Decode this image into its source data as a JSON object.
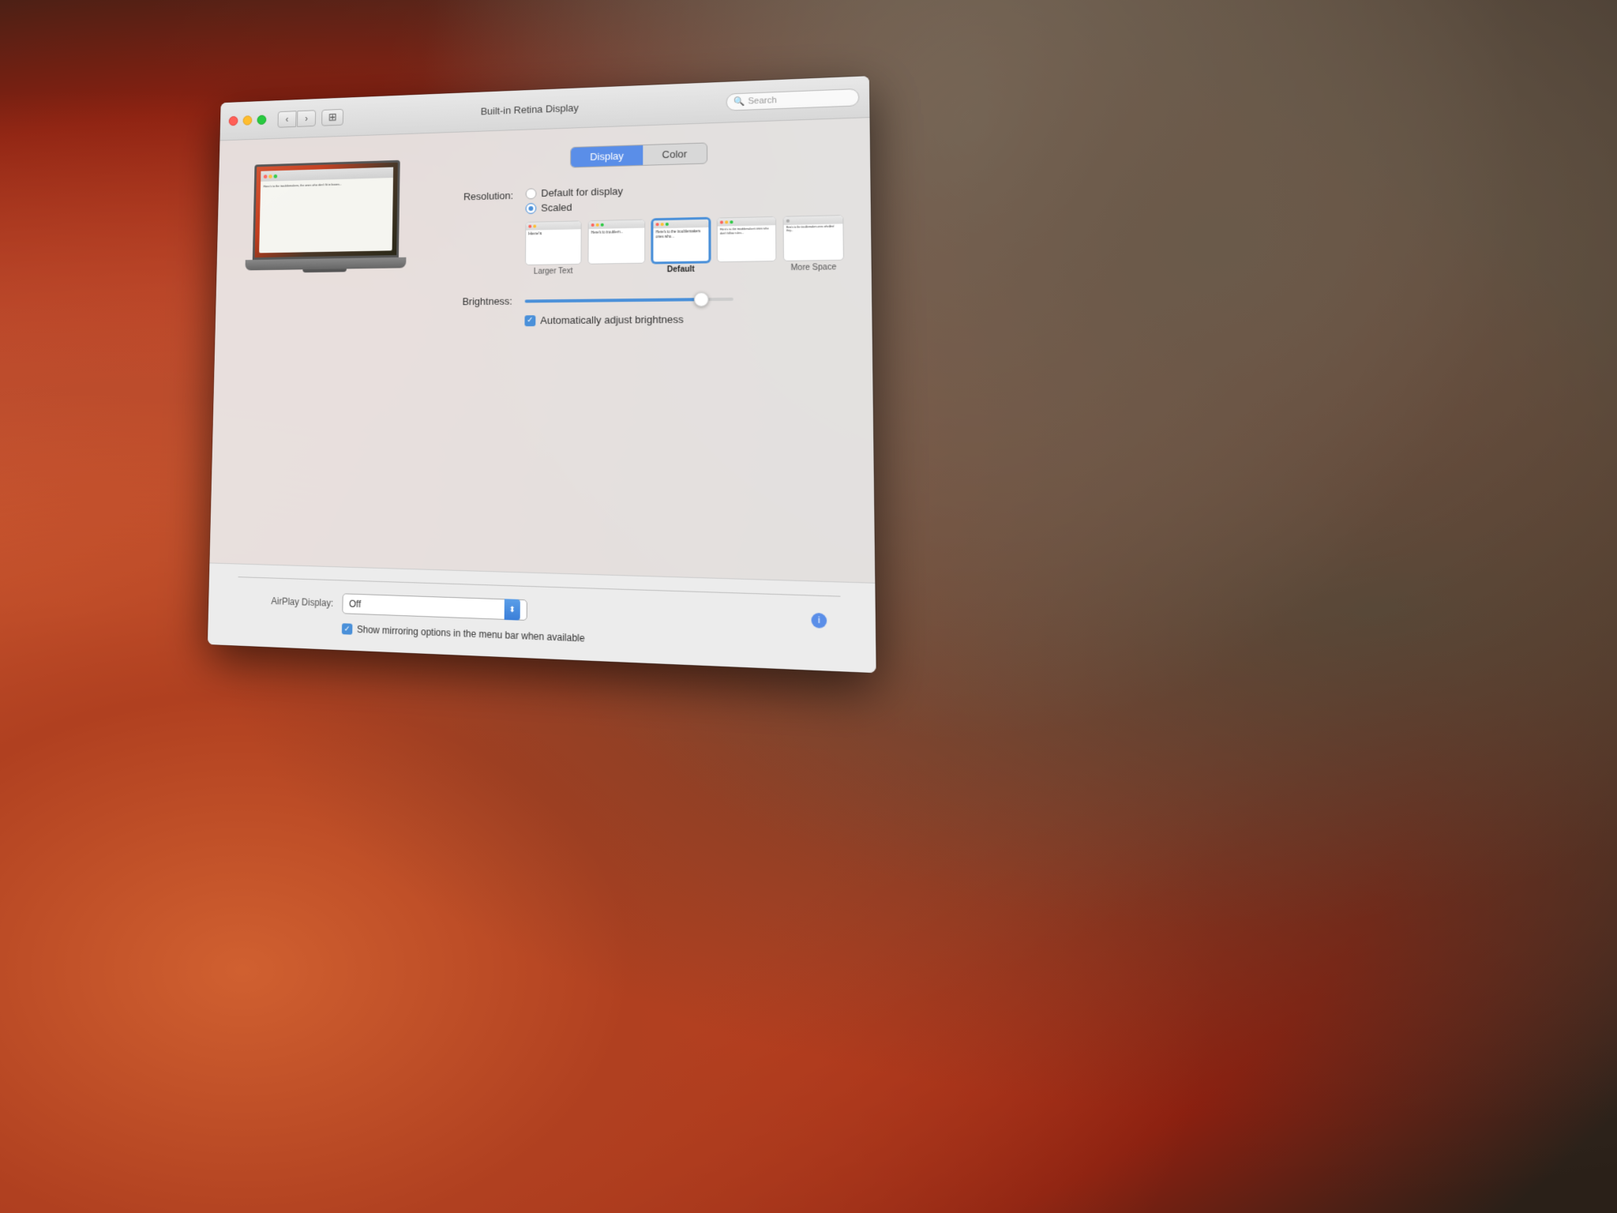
{
  "background": {
    "description": "macOS Yosemite wallpaper with El Capitan rock formation"
  },
  "window": {
    "title": "Built-in Retina Display",
    "traffic_lights": {
      "close": "close",
      "minimize": "minimize",
      "maximize": "maximize"
    },
    "nav": {
      "back": "‹",
      "forward": "›",
      "grid": "⊞"
    },
    "search": {
      "placeholder": "Search"
    }
  },
  "tabs": {
    "display": "Display",
    "color": "Color",
    "active": "display"
  },
  "resolution": {
    "label": "Resolution:",
    "option_default": "Default for display",
    "option_scaled": "Scaled",
    "selected": "scaled",
    "thumbnails": [
      {
        "id": "larger",
        "label": "Larger Text",
        "bold": false,
        "selected": false,
        "preview_text": "Here's"
      },
      {
        "id": "medium",
        "label": "",
        "bold": false,
        "selected": false,
        "preview_text": "Here's to trouble"
      },
      {
        "id": "default",
        "label": "Default",
        "bold": true,
        "selected": true,
        "preview_text": "Here's to the troublemakers ones who"
      },
      {
        "id": "more1",
        "label": "",
        "bold": false,
        "selected": false,
        "preview_text": "Here's to the troublemakers ones who don't"
      },
      {
        "id": "more2",
        "label": "More Space",
        "bold": false,
        "selected": false,
        "preview_text": "Here's to the troublemakers ones who"
      }
    ]
  },
  "brightness": {
    "label": "Brightness:",
    "value": 85,
    "auto_adjust_label": "Automatically adjust brightness",
    "auto_adjust_checked": true
  },
  "airplay": {
    "label": "AirPlay Display:",
    "value": "Off"
  },
  "mirroring": {
    "label": "Show mirroring options in the menu bar when available",
    "checked": true
  }
}
